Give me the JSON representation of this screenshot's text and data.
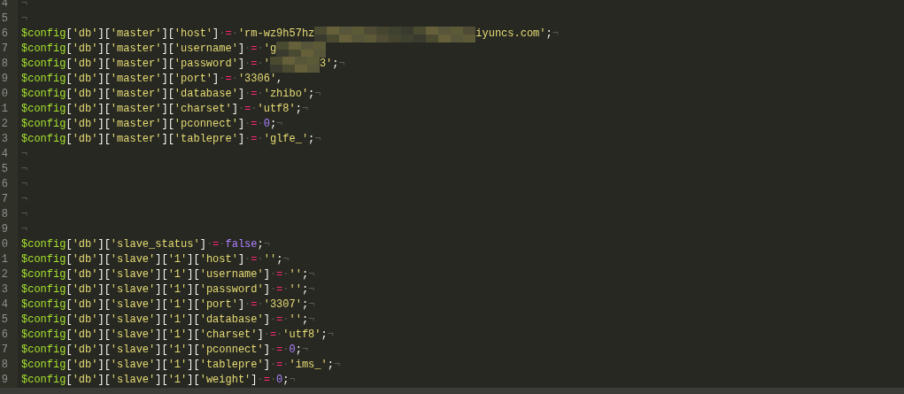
{
  "editor": {
    "lines": [
      {
        "number": "4",
        "eol": "¬"
      },
      {
        "number": "5",
        "eol": "¬"
      },
      {
        "number": "6",
        "var": "$config",
        "path": [
          "[",
          "'db'",
          "][",
          "'master'",
          "][",
          "'host'",
          "]"
        ],
        "op": [
          "·",
          "=",
          "·"
        ],
        "value": [
          {
            "kind": "string",
            "text": "'rm-wz9h57hz"
          },
          {
            "kind": "picture"
          },
          {
            "kind": "string",
            "text": "iyuncs.com'"
          },
          {
            "kind": "punct",
            "text": ";"
          }
        ],
        "eol": "¬"
      },
      {
        "number": "7",
        "var": "$config",
        "path": [
          "[",
          "'db'",
          "][",
          "'master'",
          "][",
          "'username'",
          "]"
        ],
        "op": [
          "·",
          "=",
          "·"
        ],
        "value": [
          {
            "kind": "string",
            "text": "'g"
          },
          {
            "kind": "picture"
          }
        ]
      },
      {
        "number": "8",
        "var": "$config",
        "path": [
          "[",
          "'db'",
          "][",
          "'master'",
          "][",
          "'password'",
          "]"
        ],
        "op": [
          "·",
          "=",
          "·"
        ],
        "value": [
          {
            "kind": "string",
            "text": "'"
          },
          {
            "kind": "picture"
          },
          {
            "kind": "string",
            "text": "3'"
          },
          {
            "kind": "punct",
            "text": ";"
          }
        ],
        "eol": "¬"
      },
      {
        "number": "9",
        "var": "$config",
        "path": [
          "[",
          "'db'",
          "][",
          "'master'",
          "][",
          "'port'",
          "]"
        ],
        "op": [
          "·",
          "=",
          "·"
        ],
        "value": [
          {
            "kind": "string",
            "text": "'3306'"
          },
          {
            "kind": "punct",
            "text": ","
          }
        ]
      },
      {
        "number": "0",
        "var": "$config",
        "path": [
          "[",
          "'db'",
          "][",
          "'master'",
          "][",
          "'database'",
          "]"
        ],
        "op": [
          "·",
          "=",
          "·"
        ],
        "value": [
          {
            "kind": "string",
            "text": "'zhibo'"
          },
          {
            "kind": "punct",
            "text": ";"
          }
        ],
        "eol": "¬"
      },
      {
        "number": "1",
        "var": "$config",
        "path": [
          "[",
          "'db'",
          "][",
          "'master'",
          "][",
          "'charset'",
          "]"
        ],
        "op": [
          "·",
          "=",
          "·"
        ],
        "value": [
          {
            "kind": "string",
            "text": "'utf8'"
          },
          {
            "kind": "punct",
            "text": ";"
          }
        ],
        "eol": "¬"
      },
      {
        "number": "2",
        "var": "$config",
        "path": [
          "[",
          "'db'",
          "][",
          "'master'",
          "][",
          "'pconnect'",
          "]"
        ],
        "op": [
          "·",
          "=",
          "·"
        ],
        "value": [
          {
            "kind": "number",
            "text": "0"
          },
          {
            "kind": "punct",
            "text": ";"
          }
        ],
        "eol": "¬"
      },
      {
        "number": "3",
        "var": "$config",
        "path": [
          "[",
          "'db'",
          "][",
          "'master'",
          "][",
          "'tablepre'",
          "]"
        ],
        "op": [
          "·",
          "=",
          "·"
        ],
        "value": [
          {
            "kind": "string",
            "text": "'glfe_'"
          },
          {
            "kind": "punct",
            "text": ";"
          }
        ],
        "eol": "¬"
      },
      {
        "number": "4",
        "eol": "¬"
      },
      {
        "number": "5",
        "eol": "¬"
      },
      {
        "number": "6",
        "eol": "¬"
      },
      {
        "number": "7",
        "eol": "¬"
      },
      {
        "number": "8",
        "eol": "¬"
      },
      {
        "number": "9",
        "eol": "¬"
      },
      {
        "number": "0",
        "var": "$config",
        "path": [
          "[",
          "'db'",
          "][",
          "'slave_status'",
          "]"
        ],
        "op": [
          "·",
          "=",
          "·"
        ],
        "value": [
          {
            "kind": "keyword",
            "text": "false"
          },
          {
            "kind": "punct",
            "text": ";"
          }
        ],
        "eol": "¬"
      },
      {
        "number": "1",
        "var": "$config",
        "path": [
          "[",
          "'db'",
          "][",
          "'slave'",
          "][",
          "'1'",
          "][",
          "'host'",
          "]"
        ],
        "op": [
          "·",
          "=",
          "·"
        ],
        "value": [
          {
            "kind": "string",
            "text": "''"
          },
          {
            "kind": "punct",
            "text": ";"
          }
        ],
        "eol": "¬"
      },
      {
        "number": "2",
        "var": "$config",
        "path": [
          "[",
          "'db'",
          "][",
          "'slave'",
          "][",
          "'1'",
          "][",
          "'username'",
          "]"
        ],
        "op": [
          "·",
          "=",
          "·"
        ],
        "value": [
          {
            "kind": "string",
            "text": "''"
          },
          {
            "kind": "punct",
            "text": ";"
          }
        ],
        "eol": "¬"
      },
      {
        "number": "3",
        "var": "$config",
        "path": [
          "[",
          "'db'",
          "][",
          "'slave'",
          "][",
          "'1'",
          "][",
          "'password'",
          "]"
        ],
        "op": [
          "·",
          "=",
          "·"
        ],
        "value": [
          {
            "kind": "string",
            "text": "''"
          },
          {
            "kind": "punct",
            "text": ";"
          }
        ],
        "eol": "¬"
      },
      {
        "number": "4",
        "var": "$config",
        "path": [
          "[",
          "'db'",
          "][",
          "'slave'",
          "][",
          "'1'",
          "][",
          "'port'",
          "]"
        ],
        "op": [
          "·",
          "=",
          "·"
        ],
        "value": [
          {
            "kind": "string",
            "text": "'3307'"
          },
          {
            "kind": "punct",
            "text": ";"
          }
        ],
        "eol": "¬"
      },
      {
        "number": "5",
        "var": "$config",
        "path": [
          "[",
          "'db'",
          "][",
          "'slave'",
          "][",
          "'1'",
          "][",
          "'database'",
          "]"
        ],
        "op": [
          "·",
          "=",
          "·"
        ],
        "value": [
          {
            "kind": "string",
            "text": "''"
          },
          {
            "kind": "punct",
            "text": ";"
          }
        ],
        "eol": "¬"
      },
      {
        "number": "6",
        "var": "$config",
        "path": [
          "[",
          "'db'",
          "][",
          "'slave'",
          "][",
          "'1'",
          "][",
          "'charset'",
          "]"
        ],
        "op": [
          "·",
          "=",
          "·"
        ],
        "value": [
          {
            "kind": "string",
            "text": "'utf8'"
          },
          {
            "kind": "punct",
            "text": ";"
          }
        ],
        "eol": "¬"
      },
      {
        "number": "7",
        "var": "$config",
        "path": [
          "[",
          "'db'",
          "][",
          "'slave'",
          "][",
          "'1'",
          "][",
          "'pconnect'",
          "]"
        ],
        "op": [
          "·",
          "=",
          "·"
        ],
        "value": [
          {
            "kind": "number",
            "text": "0"
          },
          {
            "kind": "punct",
            "text": ";"
          }
        ],
        "eol": "¬"
      },
      {
        "number": "8",
        "var": "$config",
        "path": [
          "[",
          "'db'",
          "][",
          "'slave'",
          "][",
          "'1'",
          "][",
          "'tablepre'",
          "]"
        ],
        "op": [
          "·",
          "=",
          "·"
        ],
        "value": [
          {
            "kind": "string",
            "text": "'ims_'"
          },
          {
            "kind": "punct",
            "text": ";"
          }
        ],
        "eol": "¬"
      },
      {
        "number": "9",
        "var": "$config",
        "path": [
          "[",
          "'db'",
          "][",
          "'slave'",
          "][",
          "'1'",
          "][",
          "'weight'",
          "]"
        ],
        "op": [
          "·",
          "=",
          "·"
        ],
        "value": [
          {
            "kind": "number",
            "text": "0"
          },
          {
            "kind": "punct",
            "text": ";"
          }
        ],
        "eol": "¬"
      }
    ]
  }
}
